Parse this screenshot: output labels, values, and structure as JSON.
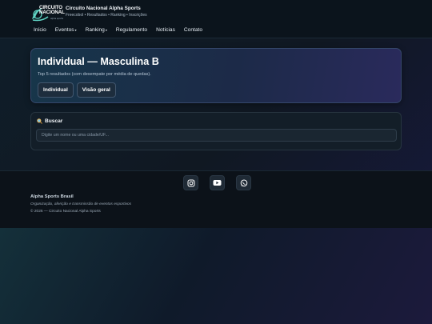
{
  "brand": {
    "logo_text_line1": "CIRCUITO",
    "logo_text_line2": "NACIONAL",
    "logo_sub": "alpha sports",
    "title": "Circuito Nacional Alpha Sports",
    "subtitle": "Freecobol • Resultados • Ranking • Inscrições",
    "accent": "#5fd3c3"
  },
  "nav": {
    "items": [
      {
        "label": "Início",
        "dropdown": false
      },
      {
        "label": "Eventos",
        "dropdown": true
      },
      {
        "label": "Ranking",
        "dropdown": true
      },
      {
        "label": "Regulamento",
        "dropdown": false
      },
      {
        "label": "Notícias",
        "dropdown": false
      },
      {
        "label": "Contato",
        "dropdown": false
      }
    ],
    "caret": "▾"
  },
  "hero": {
    "title": "Individual — Masculina B",
    "subtitle": "Top 5 resultados (com desempate por média de quedas).",
    "buttons": [
      "Individual",
      "Visão geral"
    ]
  },
  "search": {
    "label": "Buscar",
    "placeholder": "Digite um nome ou uma cidade/UF...",
    "value": "",
    "icon": "search-icon"
  },
  "footer": {
    "socials": [
      "instagram-icon",
      "youtube-icon",
      "whatsapp-icon"
    ],
    "name": "Alpha Sports Brasil",
    "description": "Organização, aferição e transmissão de eventos esportivos",
    "copyright": "© 2026 — Circuito Nacional Alpha Sports"
  }
}
